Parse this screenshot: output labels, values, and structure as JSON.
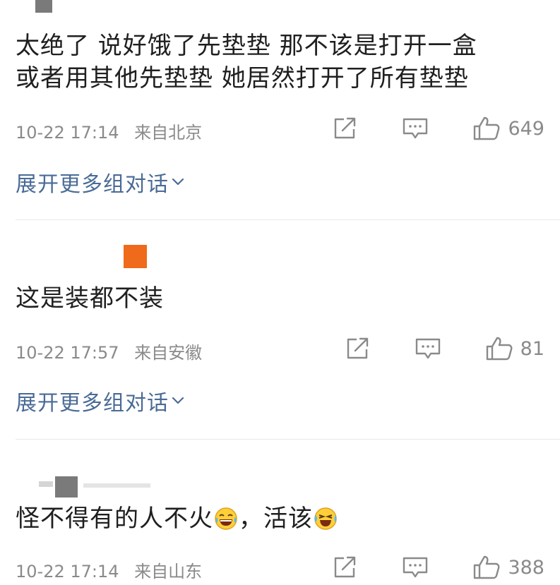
{
  "comments": [
    {
      "text_line1": "太绝了 说好饿了先垫垫 那不该是打开一盒",
      "text_line2": "或者用其他先垫垫 她居然打开了所有垫垫",
      "date": "10-22 17:14",
      "location": "来自北京",
      "likes": "649",
      "expand_label": "展开更多组对话"
    },
    {
      "text_line1": "这是装都不装",
      "date": "10-22 17:57",
      "location": "来自安徽",
      "likes": "81",
      "expand_label": "展开更多组对话"
    },
    {
      "text_part1": "怪不得有的人不火",
      "text_part2": "，活该",
      "date": "10-22 17:14",
      "location": "来自山东",
      "likes": "388"
    }
  ],
  "colors": {
    "link_blue": "#4a6b96",
    "meta_gray": "#8a8a8a",
    "avatar_orange": "#ef6a1a",
    "avatar_gray": "#7a7a7a"
  },
  "icons": [
    "share-icon",
    "comment-icon",
    "like-icon",
    "chevron-down-icon",
    "laughing-tears-emoji",
    "crying-laughing-emoji"
  ]
}
